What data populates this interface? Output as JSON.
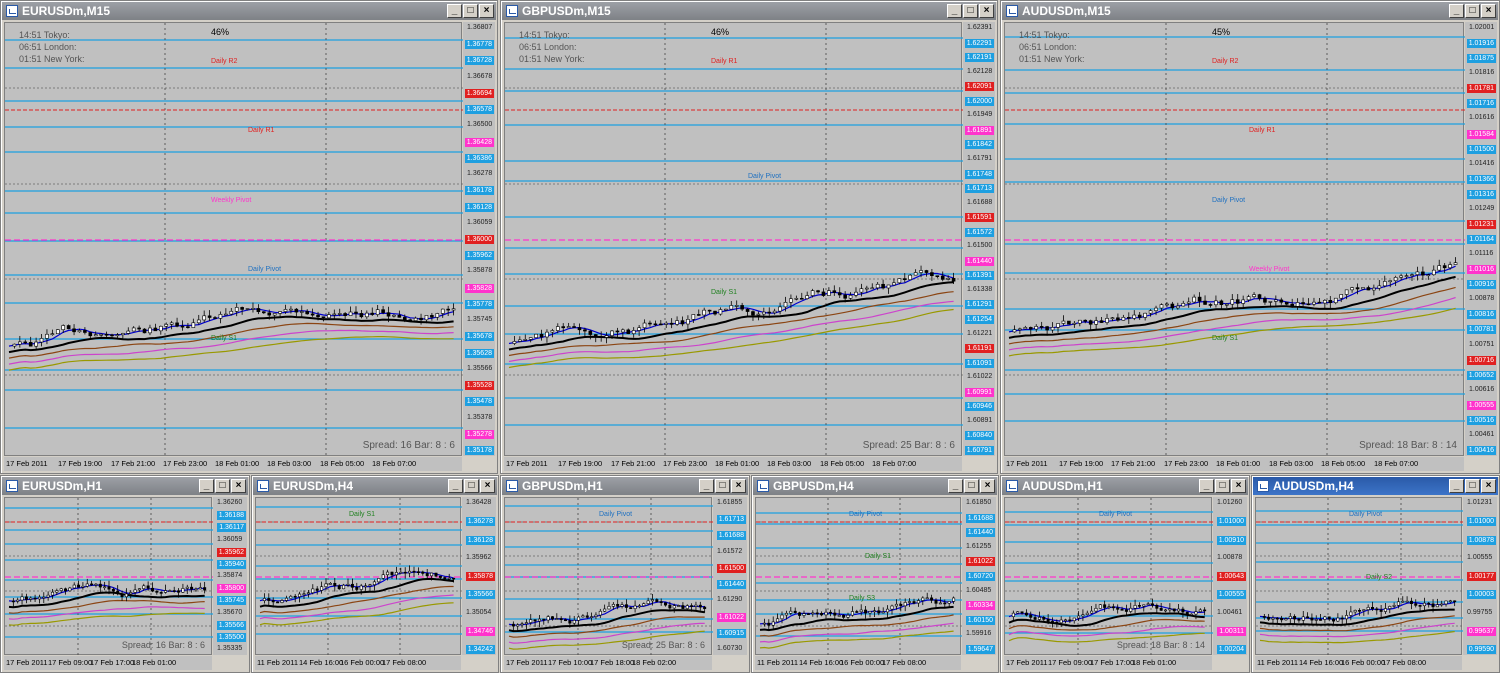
{
  "windows": [
    {
      "id": "w1",
      "title": "EURUSDm,M15",
      "active": false,
      "session": [
        "14:51 Tokyo:",
        "06:51 London:",
        "01:51 New York:"
      ],
      "pct": "46%",
      "prices": [
        "1.36807",
        "1.36778",
        "1.36728",
        "1.36678",
        "1.36694",
        "1.36578",
        "1.36500",
        "1.36428",
        "1.36386",
        "1.36278",
        "1.36178",
        "1.36128",
        "1.36059",
        "1.36000",
        "1.35962",
        "1.35878",
        "1.35828",
        "1.35778",
        "1.35745",
        "1.35678",
        "1.35628",
        "1.35566",
        "1.35528",
        "1.35478",
        "1.35378",
        "1.35278",
        "1.35178"
      ],
      "levels": [
        "Daily R2",
        "Daily R1",
        "Weekly Pivot",
        "Daily Pivot",
        "Daily S1"
      ],
      "xlabels": [
        "17 Feb 2011",
        "17 Feb 19:00",
        "17 Feb 21:00",
        "17 Feb 23:00",
        "18 Feb 01:00",
        "18 Feb 03:00",
        "18 Feb 05:00",
        "18 Feb 07:00"
      ],
      "spread": "Spread: 16",
      "bar": "Bar: 8 : 6"
    },
    {
      "id": "w2",
      "title": "GBPUSDm,M15",
      "active": false,
      "session": [
        "14:51 Tokyo:",
        "06:51 London:",
        "01:51 New York:"
      ],
      "pct": "46%",
      "prices": [
        "1.62391",
        "1.62291",
        "1.62191",
        "1.62128",
        "1.62091",
        "1.62000",
        "1.61949",
        "1.61891",
        "1.61842",
        "1.61791",
        "1.61748",
        "1.61713",
        "1.61688",
        "1.61591",
        "1.61572",
        "1.61500",
        "1.61440",
        "1.61391",
        "1.61338",
        "1.61291",
        "1.61254",
        "1.61221",
        "1.61191",
        "1.61091",
        "1.61022",
        "1.60991",
        "1.60946",
        "1.60891",
        "1.60840",
        "1.60791"
      ],
      "levels": [
        "Daily R1",
        "Daily Pivot",
        "Daily S1"
      ],
      "xlabels": [
        "17 Feb 2011",
        "17 Feb 19:00",
        "17 Feb 21:00",
        "17 Feb 23:00",
        "18 Feb 01:00",
        "18 Feb 03:00",
        "18 Feb 05:00",
        "18 Feb 07:00"
      ],
      "spread": "Spread: 25",
      "bar": "Bar: 8 : 6"
    },
    {
      "id": "w3",
      "title": "AUDUSDm,M15",
      "active": false,
      "session": [
        "14:51 Tokyo:",
        "06:51 London:",
        "01:51 New York:"
      ],
      "pct": "45%",
      "prices": [
        "1.02001",
        "1.01916",
        "1.01875",
        "1.01816",
        "1.01781",
        "1.01716",
        "1.01616",
        "1.01584",
        "1.01500",
        "1.01416",
        "1.01366",
        "1.01316",
        "1.01249",
        "1.01231",
        "1.01164",
        "1.01116",
        "1.01016",
        "1.00916",
        "1.00878",
        "1.00816",
        "1.00781",
        "1.00751",
        "1.00716",
        "1.00652",
        "1.00616",
        "1.00555",
        "1.00516",
        "1.00461",
        "1.00416"
      ],
      "levels": [
        "Daily R2",
        "Daily R1",
        "Daily Pivot",
        "Weekly Pivot",
        "Daily S1"
      ],
      "xlabels": [
        "17 Feb 2011",
        "17 Feb 19:00",
        "17 Feb 21:00",
        "17 Feb 23:00",
        "18 Feb 01:00",
        "18 Feb 03:00",
        "18 Feb 05:00",
        "18 Feb 07:00"
      ],
      "spread": "Spread: 18",
      "bar": "Bar: 8 : 14"
    },
    {
      "id": "w4",
      "title": "EURUSDm,H1",
      "active": false,
      "prices": [
        "1.36260",
        "1.36188",
        "1.36117",
        "1.36059",
        "1.35962",
        "1.35940",
        "1.35874",
        "1.35800",
        "1.35745",
        "1.35670",
        "1.35566",
        "1.35500",
        "1.35335"
      ],
      "xlabels": [
        "17 Feb 2011",
        "17 Feb 09:00",
        "17 Feb 17:00",
        "18 Feb 01:00"
      ],
      "spread": "Spread: 16",
      "bar": "Bar: 8 : 6"
    },
    {
      "id": "w5",
      "title": "EURUSDm,H4",
      "active": false,
      "prices": [
        "1.36428",
        "1.36278",
        "1.36128",
        "1.35962",
        "1.35878",
        "1.35566",
        "1.35054",
        "1.34746",
        "1.34242"
      ],
      "levels": [
        "Daily S1"
      ],
      "xlabels": [
        "11 Feb 2011",
        "14 Feb 16:00",
        "16 Feb 00:00",
        "17 Feb 08:00"
      ]
    },
    {
      "id": "w6",
      "title": "GBPUSDm,H1",
      "active": false,
      "prices": [
        "1.61855",
        "1.61713",
        "1.61688",
        "1.61572",
        "1.61500",
        "1.61440",
        "1.61290",
        "1.61022",
        "1.60915",
        "1.60730"
      ],
      "levels": [
        "Daily Pivot"
      ],
      "xlabels": [
        "17 Feb 2011",
        "17 Feb 10:00",
        "17 Feb 18:00",
        "18 Feb 02:00"
      ],
      "spread": "Spread: 25",
      "bar": "Bar: 8 : 6"
    },
    {
      "id": "w7",
      "title": "GBPUSDm,H4",
      "active": false,
      "prices": [
        "1.61850",
        "1.61688",
        "1.61440",
        "1.61255",
        "1.61022",
        "1.60720",
        "1.60485",
        "1.60334",
        "1.60150",
        "1.59916",
        "1.59647"
      ],
      "levels": [
        "Daily Pivot",
        "Daily S1",
        "Daily S3"
      ],
      "xlabels": [
        "11 Feb 2011",
        "14 Feb 16:00",
        "16 Feb 00:00",
        "17 Feb 08:00"
      ]
    },
    {
      "id": "w8",
      "title": "AUDUSDm,H1",
      "active": false,
      "prices": [
        "1.01260",
        "1.01000",
        "1.00910",
        "1.00878",
        "1.00643",
        "1.00555",
        "1.00461",
        "1.00311",
        "1.00204"
      ],
      "levels": [
        "Daily Pivot"
      ],
      "xlabels": [
        "17 Feb 2011",
        "17 Feb 09:00",
        "17 Feb 17:00",
        "18 Feb 01:00"
      ],
      "spread": "Spread: 18",
      "bar": "Bar: 8 : 14"
    },
    {
      "id": "w9",
      "title": "AUDUSDm,H4",
      "active": true,
      "prices": [
        "1.01231",
        "1.01000",
        "1.00878",
        "1.00555",
        "1.00177",
        "1.00003",
        "0.99755",
        "0.99637",
        "0.99590"
      ],
      "levels": [
        "Daily Pivot",
        "Daily S2"
      ],
      "xlabels": [
        "11 Feb 2011",
        "14 Feb 16:00",
        "16 Feb 00:00",
        "17 Feb 08:00"
      ]
    }
  ],
  "buttons": {
    "min": "_",
    "max": "□",
    "close": "×"
  },
  "colors": {
    "plot_bg": "#c0c0c0",
    "hline": "#1e9fe0",
    "pivot": "#ff33cc",
    "r": "#e02020",
    "s": "#208020"
  }
}
